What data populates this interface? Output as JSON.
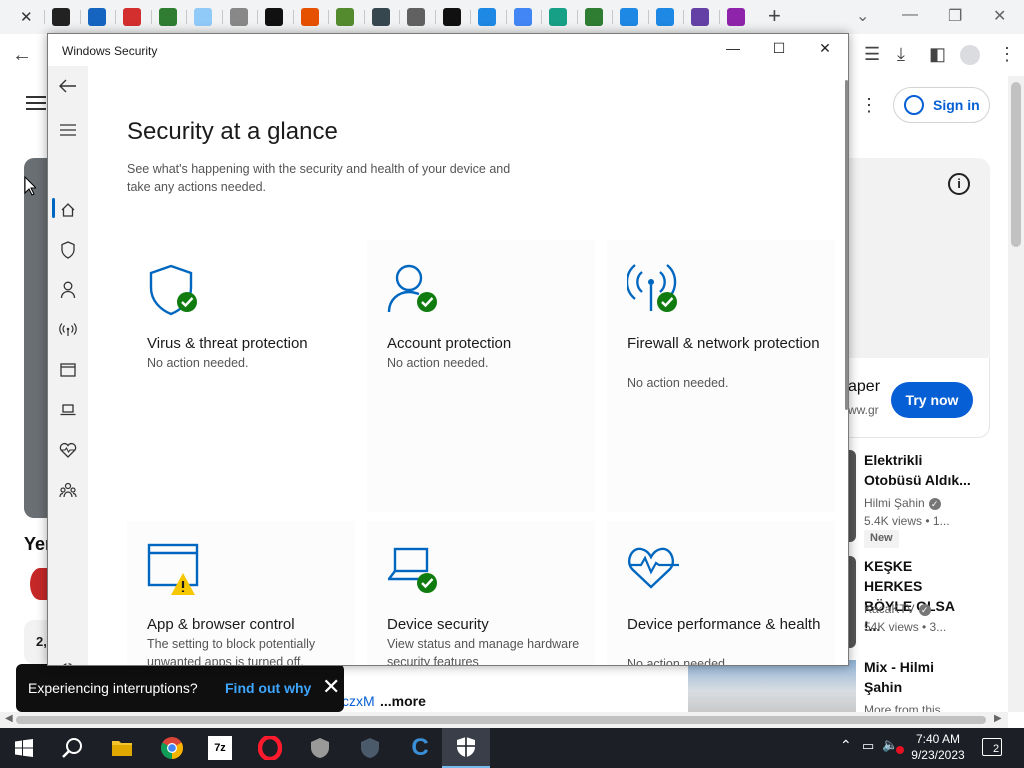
{
  "browser": {
    "tab_close": "✕",
    "new_tab": "+",
    "tab_colors": [
      "#222",
      "#1565c0",
      "#d32f2f",
      "#2e7d32",
      "#90caf9",
      "#888",
      "#111",
      "#e65100",
      "#558b2f",
      "#37474f",
      "#616161",
      "#111",
      "#1e88e5",
      "#4285f4",
      "#16a085",
      "#2e7d32",
      "#1e88e5",
      "#1e88e5",
      "#6441a5",
      "#8e24aa"
    ]
  },
  "page": {
    "signin_label": "Sign in",
    "ad_title_partial": "aper",
    "ad_url_partial": "ww.gr",
    "try_now": "Try now",
    "left_heading_partial": "Yer",
    "left_count_partial": "2,",
    "left_meta_partial": "V",
    "more_pre": "czxM",
    "more_label": "...more",
    "recommendations": [
      {
        "title": "Elektrikli Otobüsü Aldık...",
        "channel": "Hilmi Şahin",
        "meta": "5.4K views  •  1...",
        "badge": "New"
      },
      {
        "title": "KEŞKE HERKES BÖYLE OLSA !...",
        "channel": "KacaKTV",
        "meta": "54K views  •  3..."
      },
      {
        "title": "Mix - Hilmi Şahin",
        "meta": "More from this..."
      }
    ]
  },
  "snackbar": {
    "text": "Experiencing interruptions?",
    "link": "Find out why"
  },
  "security_window": {
    "title": "Windows Security",
    "heading": "Security at a glance",
    "description": "See what's happening with the security and health of your device and take any actions needed.",
    "tiles": [
      {
        "title": "Virus & threat protection",
        "status": "No action needed.",
        "icon": "shield-check-icon"
      },
      {
        "title": "Account protection",
        "status": "No action needed.",
        "icon": "account-check-icon"
      },
      {
        "title": "Firewall & network protection",
        "status": "No action needed.",
        "icon": "antenna-check-icon"
      },
      {
        "title": "App & browser control",
        "status": "The setting to block potentially unwanted apps is turned off.",
        "icon": "browser-warning-icon"
      },
      {
        "title": "Device security",
        "status": "View status and manage hardware security features",
        "icon": "laptop-check-icon"
      },
      {
        "title": "Device performance & health",
        "status": "No action needed.",
        "icon": "heart-pulse-icon"
      }
    ],
    "accent": "#0067c0",
    "ok_color": "#107c10",
    "warn_color": "#f7c800"
  },
  "taskbar": {
    "time": "7:40 AM",
    "date": "9/23/2023",
    "notification_count": "2"
  }
}
